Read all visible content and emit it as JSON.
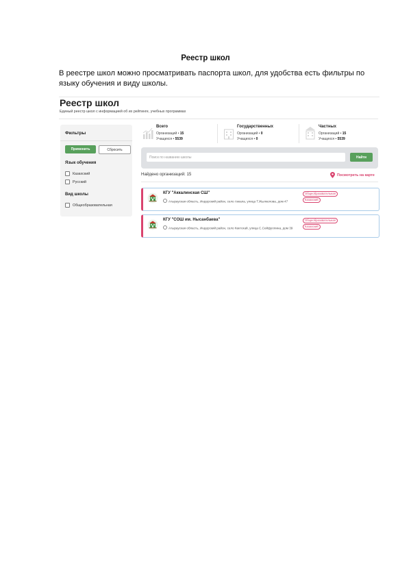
{
  "document": {
    "heading": "Реестр школ",
    "intro": "В реестре школ можно просматривать паспорта школ, для удобства есть фильтры по языку обучения и виду школы."
  },
  "registry": {
    "title": "Реестр школ",
    "subtitle": "Единый реестр школ с информацией об их рейтинге, учебных программах"
  },
  "filters": {
    "title": "Фильтры",
    "apply_label": "Применить",
    "reset_label": "Сбросить",
    "language_title": "Язык обучения",
    "languages": [
      "Казахский",
      "Русский"
    ],
    "school_type_title": "Вид школы",
    "school_types": [
      "Общеобразовательная"
    ]
  },
  "stats": [
    {
      "title": "Всего",
      "orgs_label": "Организаций",
      "orgs": "15",
      "students_label": "Учащихся",
      "students": "5539",
      "icon": "chart-icon"
    },
    {
      "title": "Государственных",
      "orgs_label": "Организаций",
      "orgs": "0",
      "students_label": "Учащихся",
      "students": "0",
      "icon": "building-icon"
    },
    {
      "title": "Частных",
      "orgs_label": "Организаций",
      "orgs": "15",
      "students_label": "Учащихся",
      "students": "5539",
      "icon": "building-icon"
    }
  ],
  "search": {
    "placeholder": "Поиск по названию школы",
    "button_label": "Найти"
  },
  "results": {
    "found_text": "Найдено организаций: 15",
    "map_link": "Посмотреть на карте"
  },
  "schools": [
    {
      "name": "КГУ \"Аккалинская СШ\"",
      "address": "Атырауская область, Индерский район, село Аккала, улица Т.Жылкелова, дом 47",
      "tags": [
        "Общеобразовательная",
        "Казахский"
      ]
    },
    {
      "name": "КГУ \"СОШ им. Нысанбаева\"",
      "address": "Атырауская область, Индерский район, село Көктоғай, улица С.Сейфуллина, дом 39",
      "tags": [
        "Общеобразовательная",
        "Казахский"
      ]
    }
  ],
  "colors": {
    "accent_green": "#58a05c",
    "accent_pink": "#d9436e",
    "card_border": "#a8cbe8"
  }
}
